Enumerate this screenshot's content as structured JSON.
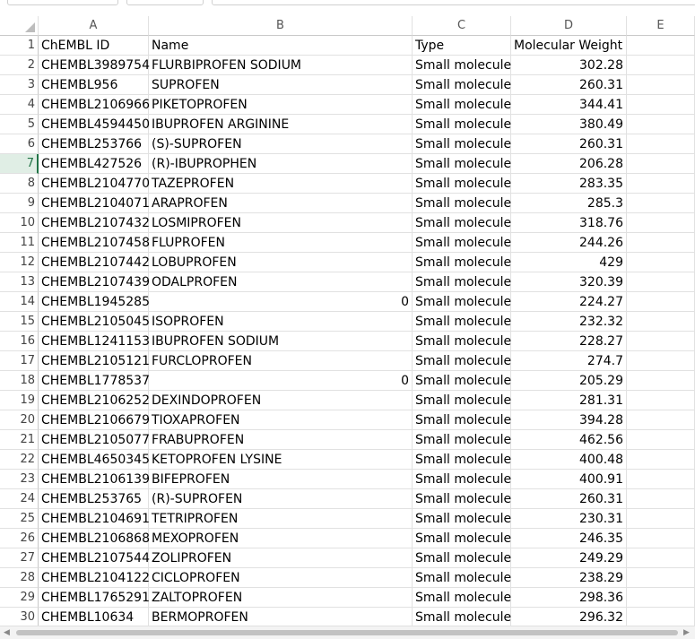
{
  "columns": [
    "A",
    "B",
    "C",
    "D",
    "E"
  ],
  "header_row": {
    "row": "1",
    "a": "ChEMBL ID",
    "b": "Name",
    "c": "Type",
    "d": "Molecular Weight"
  },
  "selected_row": "7",
  "rows": [
    {
      "row": "2",
      "a": "CHEMBL3989754",
      "b": "FLURBIPROFEN SODIUM",
      "c": "Small molecule",
      "d": "302.28"
    },
    {
      "row": "3",
      "a": "CHEMBL956",
      "b": "SUPROFEN",
      "c": "Small molecule",
      "d": "260.31"
    },
    {
      "row": "4",
      "a": "CHEMBL2106966",
      "b": "PIKETOPROFEN",
      "c": "Small molecule",
      "d": "344.41"
    },
    {
      "row": "5",
      "a": "CHEMBL4594450",
      "b": "IBUPROFEN ARGININE",
      "c": "Small molecule",
      "d": "380.49"
    },
    {
      "row": "6",
      "a": "CHEMBL253766",
      "b": "(S)-SUPROFEN",
      "c": "Small molecule",
      "d": "260.31"
    },
    {
      "row": "7",
      "a": "CHEMBL427526",
      "b": "(R)-IBUPROPHEN",
      "c": "Small molecule",
      "d": "206.28"
    },
    {
      "row": "8",
      "a": "CHEMBL2104770",
      "b": "TAZEPROFEN",
      "c": "Small molecule",
      "d": "283.35"
    },
    {
      "row": "9",
      "a": "CHEMBL2104071",
      "b": "ARAPROFEN",
      "c": "Small molecule",
      "d": "285.3"
    },
    {
      "row": "10",
      "a": "CHEMBL2107432",
      "b": "LOSMIPROFEN",
      "c": "Small molecule",
      "d": "318.76"
    },
    {
      "row": "11",
      "a": "CHEMBL2107458",
      "b": "FLUPROFEN",
      "c": "Small molecule",
      "d": "244.26"
    },
    {
      "row": "12",
      "a": "CHEMBL2107442",
      "b": "LOBUPROFEN",
      "c": "Small molecule",
      "d": "429"
    },
    {
      "row": "13",
      "a": "CHEMBL2107439",
      "b": "ODALPROFEN",
      "c": "Small molecule",
      "d": "320.39"
    },
    {
      "row": "14",
      "a": "CHEMBL1945285",
      "b": "0",
      "b_numeric": true,
      "c": "Small molecule",
      "d": "224.27"
    },
    {
      "row": "15",
      "a": "CHEMBL2105045",
      "b": "ISOPROFEN",
      "c": "Small molecule",
      "d": "232.32"
    },
    {
      "row": "16",
      "a": "CHEMBL1241153",
      "b": "IBUPROFEN SODIUM",
      "c": "Small molecule",
      "d": "228.27"
    },
    {
      "row": "17",
      "a": "CHEMBL2105121",
      "b": "FURCLOPROFEN",
      "c": "Small molecule",
      "d": "274.7"
    },
    {
      "row": "18",
      "a": "CHEMBL1778537",
      "b": "0",
      "b_numeric": true,
      "c": "Small molecule",
      "d": "205.29"
    },
    {
      "row": "19",
      "a": "CHEMBL2106252",
      "b": "DEXINDOPROFEN",
      "c": "Small molecule",
      "d": "281.31"
    },
    {
      "row": "20",
      "a": "CHEMBL2106679",
      "b": "TIOXAPROFEN",
      "c": "Small molecule",
      "d": "394.28"
    },
    {
      "row": "21",
      "a": "CHEMBL2105077",
      "b": "FRABUPROFEN",
      "c": "Small molecule",
      "d": "462.56"
    },
    {
      "row": "22",
      "a": "CHEMBL4650345",
      "b": "KETOPROFEN LYSINE",
      "c": "Small molecule",
      "d": "400.48"
    },
    {
      "row": "23",
      "a": "CHEMBL2106139",
      "b": "BIFEPROFEN",
      "c": "Small molecule",
      "d": "400.91"
    },
    {
      "row": "24",
      "a": "CHEMBL253765",
      "b": "(R)-SUPROFEN",
      "c": "Small molecule",
      "d": "260.31"
    },
    {
      "row": "25",
      "a": "CHEMBL2104691",
      "b": "TETRIPROFEN",
      "c": "Small molecule",
      "d": "230.31"
    },
    {
      "row": "26",
      "a": "CHEMBL2106868",
      "b": "MEXOPROFEN",
      "c": "Small molecule",
      "d": "246.35"
    },
    {
      "row": "27",
      "a": "CHEMBL2107544",
      "b": "ZOLIPROFEN",
      "c": "Small molecule",
      "d": "249.29"
    },
    {
      "row": "28",
      "a": "CHEMBL2104122",
      "b": "CICLOPROFEN",
      "c": "Small molecule",
      "d": "238.29"
    },
    {
      "row": "29",
      "a": "CHEMBL1765291",
      "b": "ZALTOPROFEN",
      "c": "Small molecule",
      "d": "298.36"
    },
    {
      "row": "30",
      "a": "CHEMBL10634",
      "b": "BERMOPROFEN",
      "c": "Small molecule",
      "d": "296.32"
    }
  ],
  "icons": {
    "scroll_left": "scroll-left-arrow-icon",
    "scroll_right": "scroll-right-arrow-icon",
    "select_all": "select-all-corner-icon"
  },
  "colors": {
    "selection_accent": "#217346",
    "selection_bg": "#e0eee5",
    "gridline": "#e1e1e1"
  }
}
